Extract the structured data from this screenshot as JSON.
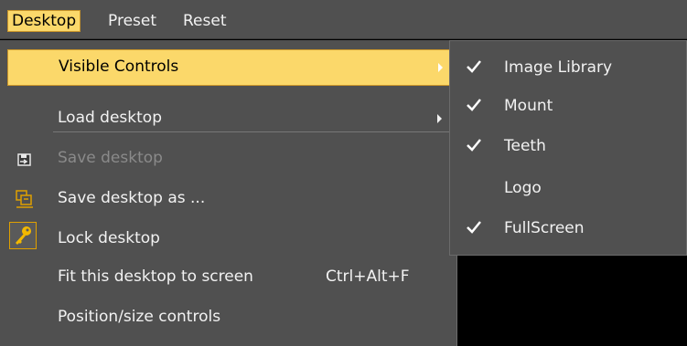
{
  "menubar": {
    "items": [
      {
        "label": "Desktop",
        "active": true
      },
      {
        "label": "Preset",
        "active": false
      },
      {
        "label": "Reset",
        "active": false
      }
    ]
  },
  "dropdown": {
    "items": [
      {
        "label": "Visible Controls",
        "has_submenu": true,
        "highlighted": true
      },
      {
        "label": "Load desktop",
        "has_submenu": true
      },
      {
        "label": "Save desktop",
        "disabled": true,
        "icon": "save-desktop-icon"
      },
      {
        "label": "Save desktop as ...",
        "icon": "save-as-icon"
      },
      {
        "label": "Lock desktop",
        "icon": "key-icon"
      },
      {
        "label": "Fit this desktop to screen",
        "shortcut": "Ctrl+Alt+F"
      },
      {
        "label": "Position/size controls"
      }
    ]
  },
  "submenu": {
    "items": [
      {
        "label": "Image Library",
        "checked": true
      },
      {
        "label": "Mount",
        "checked": true
      },
      {
        "label": "Teeth",
        "checked": true
      },
      {
        "label": "Logo",
        "checked": false
      },
      {
        "label": "FullScreen",
        "checked": true
      }
    ]
  },
  "colors": {
    "highlight": "#fbd86a",
    "menu_bg": "#505050",
    "text": "#f2f2f2",
    "disabled_text": "#8a8a8a",
    "icon_accent": "#e0a000"
  }
}
